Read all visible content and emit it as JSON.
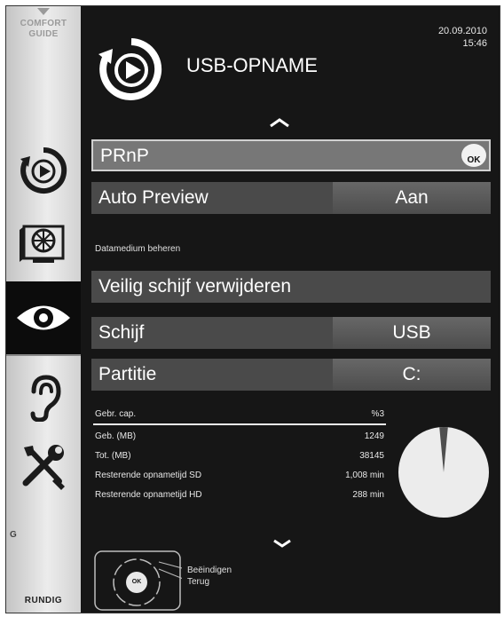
{
  "sidebar": {
    "comfort_line1": "COMFORT",
    "comfort_line2": "GUIDE",
    "letter": "G",
    "brand": "RUNDIG"
  },
  "header": {
    "title": "USB-OPNAME",
    "date": "20.09.2010",
    "time": "15:46"
  },
  "menu": {
    "prnp_label": "PRnP",
    "ok_label": "OK",
    "auto_preview_label": "Auto Preview",
    "auto_preview_value": "Aan",
    "section_label": "Datamedium beheren",
    "safe_remove_label": "Veilig schijf verwijderen",
    "disk_label": "Schijf",
    "disk_value": "USB",
    "partition_label": "Partitie",
    "partition_value": "C:"
  },
  "stats": [
    {
      "label": "Gebr. cap.",
      "value": "%3"
    },
    {
      "label": "Geb. (MB)",
      "value": "1249"
    },
    {
      "label": "Tot. (MB)",
      "value": "38145"
    },
    {
      "label": "Resterende opnametijd SD",
      "value": "1,008 min"
    },
    {
      "label": "Resterende opnametijd HD",
      "value": "288 min"
    }
  ],
  "usage_fraction": 0.03,
  "colors": {
    "background": "#161616",
    "row": "#4a4a4a",
    "pie": "#ececec",
    "pie_used": "#4f4f4f"
  },
  "hints": {
    "remote_ok": "OK",
    "exit": "Beëindigen",
    "back": "Terug"
  }
}
